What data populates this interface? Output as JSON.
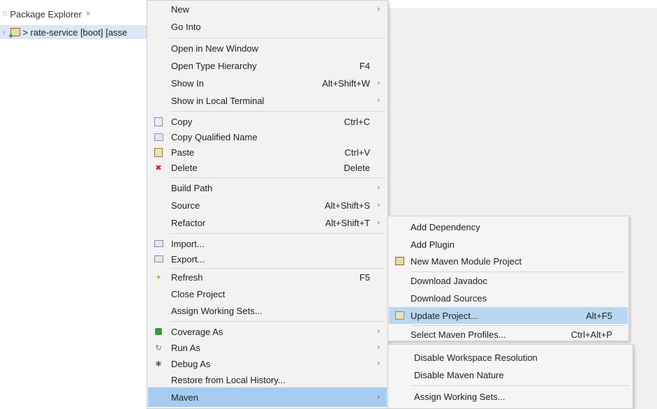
{
  "explorer": {
    "tab_title": "Package Explorer",
    "close_glyph": "×",
    "project_row": "> rate-service [boot] [asse"
  },
  "main_menu": {
    "items": [
      {
        "label": "New",
        "accel": "",
        "submenu": true
      },
      {
        "label": "Go Into",
        "accel": "",
        "submenu": false
      },
      {
        "label": "Open in New Window",
        "accel": "",
        "submenu": false
      },
      {
        "label": "Open Type Hierarchy",
        "accel": "F4",
        "submenu": false
      },
      {
        "label": "Show In",
        "accel": "Alt+Shift+W",
        "submenu": true
      },
      {
        "label": "Show in Local Terminal",
        "accel": "",
        "submenu": true
      },
      {
        "label": "Copy",
        "accel": "Ctrl+C",
        "icon": "copy-icon"
      },
      {
        "label": "Copy Qualified Name",
        "accel": "",
        "icon": "copy-qualified-name-icon"
      },
      {
        "label": "Paste",
        "accel": "Ctrl+V",
        "icon": "paste-icon"
      },
      {
        "label": "Delete",
        "accel": "Delete",
        "icon": "delete-icon"
      },
      {
        "label": "Build Path",
        "accel": "",
        "submenu": true
      },
      {
        "label": "Source",
        "accel": "Alt+Shift+S",
        "submenu": true
      },
      {
        "label": "Refactor",
        "accel": "Alt+Shift+T",
        "submenu": true
      },
      {
        "label": "Import...",
        "accel": "",
        "icon": "import-icon"
      },
      {
        "label": "Export...",
        "accel": "",
        "icon": "export-icon"
      },
      {
        "label": "Refresh",
        "accel": "F5",
        "icon": "refresh-icon"
      },
      {
        "label": "Close Project",
        "accel": ""
      },
      {
        "label": "Assign Working Sets...",
        "accel": ""
      },
      {
        "label": "Coverage As",
        "accel": "",
        "submenu": true,
        "icon": "coverage-icon"
      },
      {
        "label": "Run As",
        "accel": "",
        "submenu": true,
        "icon": "run-icon"
      },
      {
        "label": "Debug As",
        "accel": "",
        "submenu": true,
        "icon": "debug-icon"
      },
      {
        "label": "Restore from Local History...",
        "accel": ""
      },
      {
        "label": "Maven",
        "accel": "",
        "submenu": true,
        "selected": true
      }
    ]
  },
  "maven_menu": {
    "items": [
      {
        "label": "Add Dependency",
        "accel": ""
      },
      {
        "label": "Add Plugin",
        "accel": ""
      },
      {
        "label": "New Maven Module Project",
        "accel": "",
        "icon": "maven-module-icon"
      },
      {
        "label": "Download Javadoc",
        "accel": ""
      },
      {
        "label": "Download Sources",
        "accel": ""
      },
      {
        "label": "Update Project...",
        "accel": "Alt+F5",
        "icon": "update-project-icon",
        "highlighted": true
      },
      {
        "label": "Select Maven Profiles...",
        "accel": "Ctrl+Alt+P"
      }
    ]
  },
  "sub_menu2": {
    "items": [
      {
        "label": "Disable Workspace Resolution"
      },
      {
        "label": "Disable Maven Nature"
      },
      {
        "label": "Assign Working Sets..."
      }
    ]
  },
  "glyphs": {
    "submenu_arrow": "›"
  },
  "colors": {
    "selection": "#a6cdef",
    "hover": "#b9d7f2",
    "menu_bg": "#f2f2f2"
  }
}
